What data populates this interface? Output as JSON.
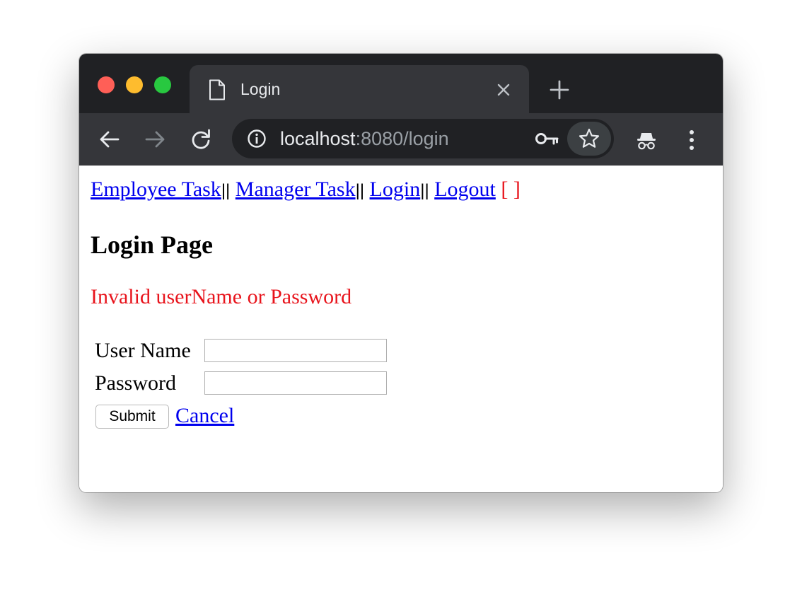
{
  "browser": {
    "tab": {
      "title": "Login",
      "icon": "document-icon",
      "close_icon": "close-icon"
    },
    "new_tab_icon": "plus-icon",
    "toolbar": {
      "back_icon": "arrow-left-icon",
      "forward_icon": "arrow-right-icon",
      "reload_icon": "reload-icon",
      "incognito_icon": "incognito-icon",
      "menu_icon": "kebab-menu-icon"
    },
    "address_bar": {
      "info_icon": "info-icon",
      "host": "localhost",
      "path": ":8080/login",
      "key_icon": "key-icon",
      "bookmark_icon": "star-icon"
    },
    "colors": {
      "tabstrip": "#202124",
      "toolbar": "#35363a",
      "traffic_red": "#ff5f57",
      "traffic_yellow": "#febc2e",
      "traffic_green": "#28c840"
    }
  },
  "page": {
    "nav": {
      "items": [
        {
          "label": "Employee Task"
        },
        {
          "label": "Manager Task"
        },
        {
          "label": "Login"
        },
        {
          "label": "Logout"
        }
      ],
      "separator": "||",
      "user_display": "[ ]"
    },
    "title": "Login Page",
    "error_message": "Invalid userName or Password",
    "form": {
      "username_label": "User Name",
      "username_value": "",
      "password_label": "Password",
      "password_value": "",
      "submit_label": "Submit",
      "cancel_label": "Cancel"
    },
    "colors": {
      "link": "#0000ee",
      "error": "#e8141c"
    }
  }
}
